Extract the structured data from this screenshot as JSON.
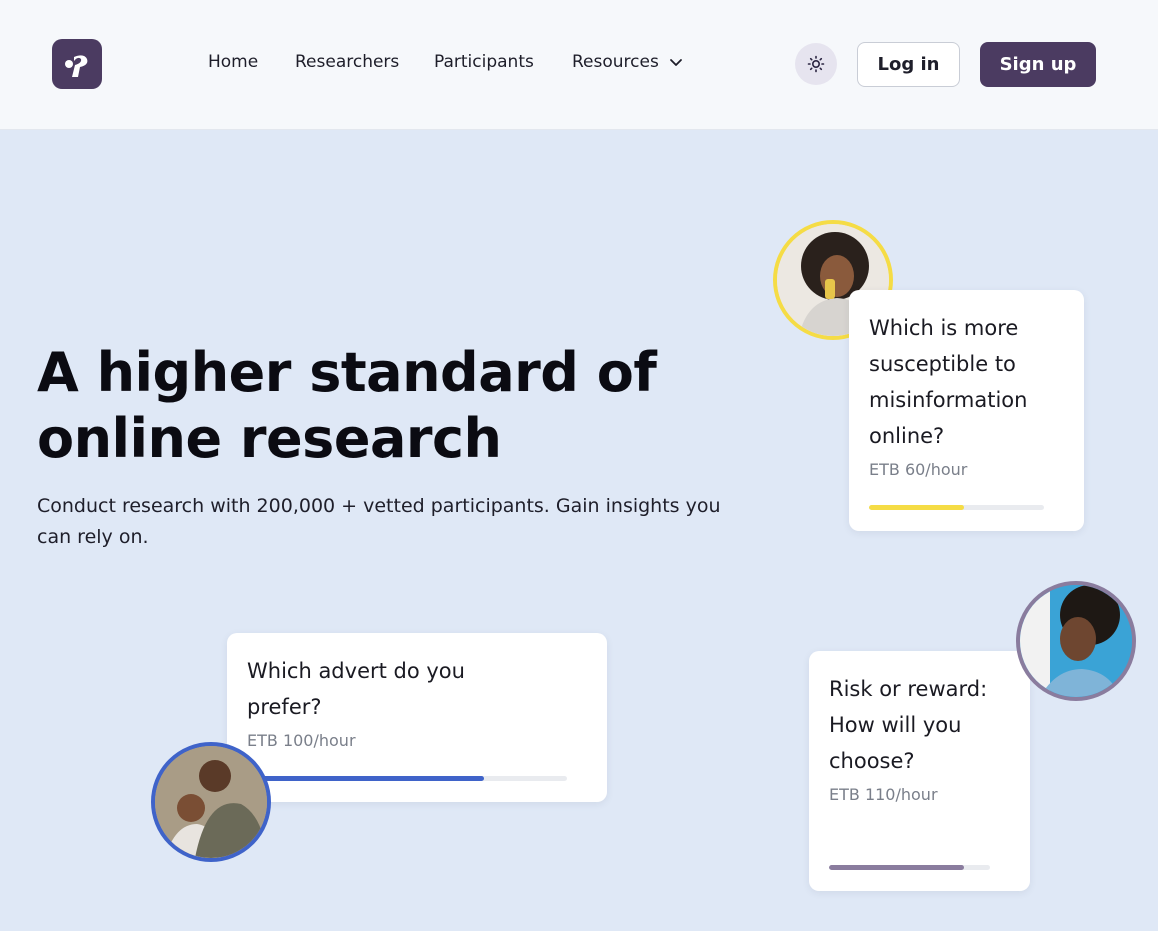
{
  "header": {
    "logo_alt": "Prolific logo",
    "nav": [
      {
        "label": "Home"
      },
      {
        "label": "Researchers"
      },
      {
        "label": "Participants"
      },
      {
        "label": "Resources"
      }
    ],
    "theme_toggle_icon": "sun-icon",
    "login_label": "Log in",
    "signup_label": "Sign up"
  },
  "hero": {
    "title_line1": "A higher standard of",
    "title_line2": "online research",
    "subtitle": "Conduct research with 200,000 + vetted participants. Gain insights you can rely on."
  },
  "cards": [
    {
      "question": "Which is more susceptible to misinformation online?",
      "rate": "ETB 60/hour",
      "progress": 0.54,
      "color": "#f5dc45"
    },
    {
      "question": "Which advert do you prefer?",
      "rate": "ETB 100/hour",
      "progress": 0.74,
      "color": "#3f63c9"
    },
    {
      "question": "Risk or reward: How will you choose?",
      "rate": "ETB 110/hour",
      "progress": 0.84,
      "color": "#8a7c9e"
    }
  ],
  "colors": {
    "brand": "#4b3b61",
    "hero_bg": "#dfe8f6",
    "header_bg": "#f6f8fb"
  }
}
